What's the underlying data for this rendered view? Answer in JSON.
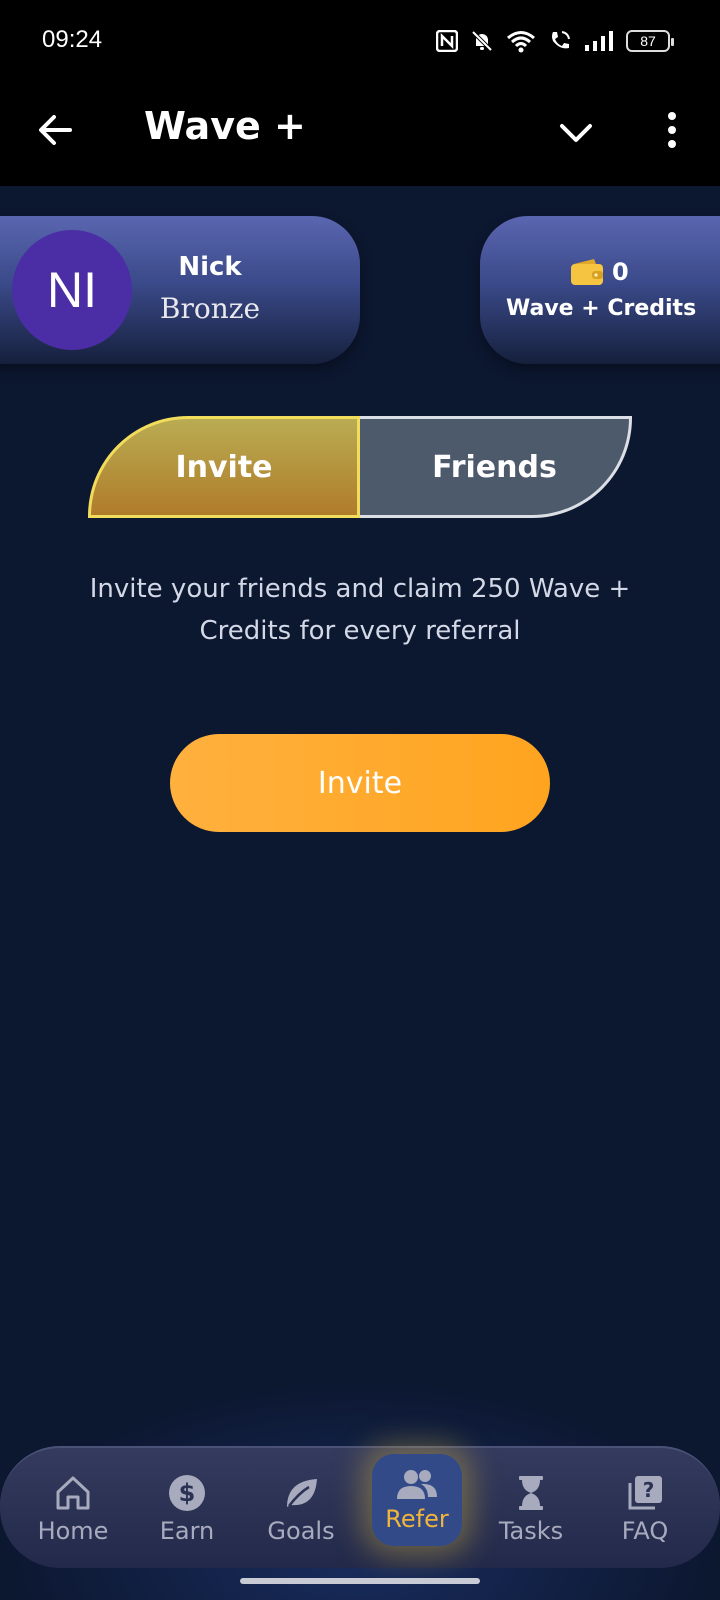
{
  "status_bar": {
    "time": "09:24",
    "battery": "87"
  },
  "app_bar": {
    "title": "Wave +"
  },
  "profile": {
    "initials": "NI",
    "name": "Nick",
    "tier": "Bronze"
  },
  "credits": {
    "value": "0",
    "label": "Wave + Credits",
    "icon": "wallet-icon"
  },
  "tabs": [
    {
      "label": "Invite",
      "active": true
    },
    {
      "label": "Friends",
      "active": false
    }
  ],
  "invite": {
    "description": "Invite your friends and claim 250 Wave + Credits for every referral",
    "button_label": "Invite"
  },
  "nav": {
    "items": [
      {
        "label": "Home",
        "icon": "home-icon"
      },
      {
        "label": "Earn",
        "icon": "dollar-icon"
      },
      {
        "label": "Goals",
        "icon": "leaf-icon"
      },
      {
        "label": "Refer",
        "icon": "people-icon",
        "active": true
      },
      {
        "label": "Tasks",
        "icon": "hourglass-icon"
      },
      {
        "label": "FAQ",
        "icon": "question-icon"
      }
    ]
  },
  "colors": {
    "background": "#0c1730",
    "accent_orange": "#ffa41f",
    "active_nav": "#f1b53b",
    "avatar": "#4b2ea6"
  }
}
